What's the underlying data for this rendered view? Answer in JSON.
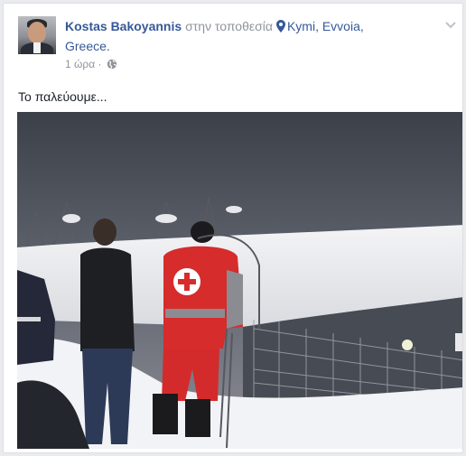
{
  "post": {
    "author": "Kostas Bakoyannis",
    "location_connector": "στην τοποθεσία",
    "location_line1": "Kymi, Evvoia,",
    "location_line2": "Greece.",
    "timestamp": "1 ώρα",
    "separator": "·",
    "text": "Το παλεύουμε...",
    "privacy_icon": "globe-icon",
    "location_icon": "map-pin-icon",
    "menu_icon": "chevron-down-icon"
  },
  "colors": {
    "link": "#365899",
    "meta": "#90949c",
    "body_text": "#1d2129"
  }
}
